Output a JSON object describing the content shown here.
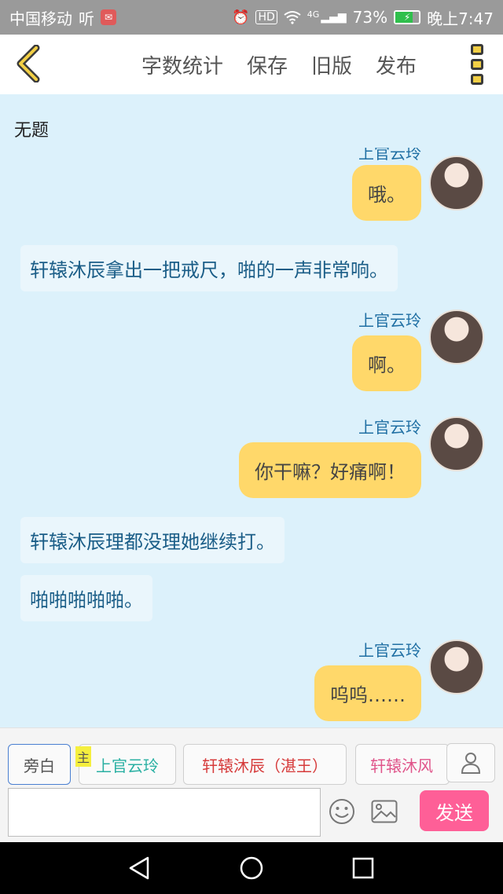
{
  "status_bar": {
    "carrier": "中国移动",
    "app_glyph": "听",
    "notif_glyph": "✉",
    "alarm_icon": "⏰",
    "hd": "HD",
    "network": "4G",
    "signal": "▂▄▆",
    "battery_percent": "73%",
    "battery_level": 73,
    "time": "晚上7:47"
  },
  "toolbar": {
    "back_label": "back",
    "word_count": "字数统计",
    "save": "保存",
    "old_version": "旧版",
    "publish": "发布"
  },
  "chat": {
    "title": "无题",
    "messages": [
      {
        "type": "right",
        "sender": "上官云玲",
        "text": "哦。"
      },
      {
        "type": "narration",
        "text": "轩辕沐辰拿出一把戒尺，啪的一声非常响。"
      },
      {
        "type": "right",
        "sender": "上官云玲",
        "text": "啊。"
      },
      {
        "type": "right",
        "sender": "上官云玲",
        "text": "你干嘛？好痛啊！"
      },
      {
        "type": "narration",
        "text": "轩辕沐辰理都没理她继续打。"
      },
      {
        "type": "narration",
        "text": "啪啪啪啪啪。"
      },
      {
        "type": "right",
        "sender": "上官云玲",
        "text": "呜呜……"
      }
    ]
  },
  "selector": {
    "narration": "旁白",
    "main_badge": "主",
    "characters": [
      "上官云玲",
      "轩辕沐辰（湛王）",
      "轩辕沐风"
    ]
  },
  "input": {
    "placeholder": "",
    "value": "",
    "send": "发送"
  },
  "colors": {
    "status_bar": "#9a9a9a",
    "chat_bg": "#dcf1fb",
    "bubble": "#ffd86a",
    "narration_text": "#1a5d87",
    "send_button": "#fe5f97"
  }
}
